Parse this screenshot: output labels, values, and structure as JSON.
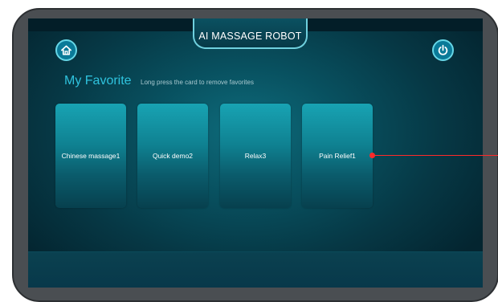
{
  "app": {
    "title": "AI MASSAGE ROBOT"
  },
  "header": {
    "home_icon": "home-icon",
    "power_icon": "power-icon"
  },
  "favorites": {
    "heading": "My Favorite",
    "hint": "Long press the card to remove favorites",
    "cards": [
      {
        "label": "Chinese massage1"
      },
      {
        "label": "Quick demo2"
      },
      {
        "label": "Relax3"
      },
      {
        "label": "Pain Relief1"
      }
    ]
  },
  "colors": {
    "accent": "#2fc3de",
    "button_border": "#66d6e6",
    "callout": "#ff2a2a"
  }
}
